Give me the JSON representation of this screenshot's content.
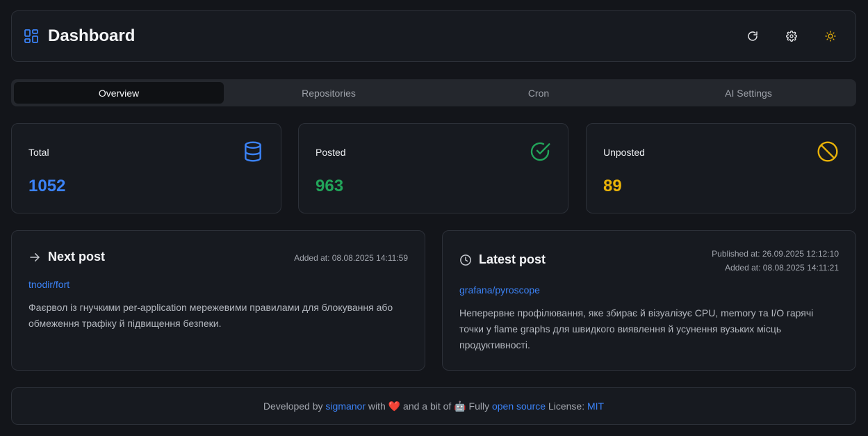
{
  "header": {
    "title": "Dashboard",
    "icons": [
      "dashboard-icon",
      "refresh-icon",
      "settings-icon",
      "sun-icon"
    ]
  },
  "tabs": [
    {
      "label": "Overview",
      "active": true
    },
    {
      "label": "Repositories",
      "active": false
    },
    {
      "label": "Cron",
      "active": false
    },
    {
      "label": "AI Settings",
      "active": false
    }
  ],
  "stats": {
    "total": {
      "label": "Total",
      "value": "1052",
      "color": "#3b82f6",
      "icon": "database-icon"
    },
    "posted": {
      "label": "Posted",
      "value": "963",
      "color": "#22a55a",
      "icon": "check-circle-icon"
    },
    "unposted": {
      "label": "Unposted",
      "value": "89",
      "color": "#eab308",
      "icon": "circle-off-icon"
    }
  },
  "next_post": {
    "title": "Next post",
    "added": "Added at: 08.08.2025 14:11:59",
    "repo": "tnodir/fort",
    "description": "Фаєрвол із гнучкими per-application мережевими правилами для блокування або обмеження трафіку й підвищення безпеки."
  },
  "latest_post": {
    "title": "Latest post",
    "published": "Published at: 26.09.2025 12:12:10",
    "added": "Added at: 08.08.2025 14:11:21",
    "repo": "grafana/pyroscope",
    "description": "Неперервне профілювання, яке збирає й візуалізує CPU, memory та I/O гарячі точки у flame graphs для швидкого виявлення й усунення вузьких місць продуктивності."
  },
  "footer": {
    "developed_by": "Developed by ",
    "author": "sigmanor",
    "with": " with ",
    "heart": "❤️",
    "and_a_bit_of": " and a bit of ",
    "robot": "🤖",
    "fully": " Fully ",
    "open_source": "open source",
    "license_label": " License: ",
    "license": "MIT"
  },
  "colors": {
    "accent": "#3b82f6",
    "success": "#22a55a",
    "warning": "#eab308",
    "background": "#13151a",
    "card": "#171a20"
  }
}
